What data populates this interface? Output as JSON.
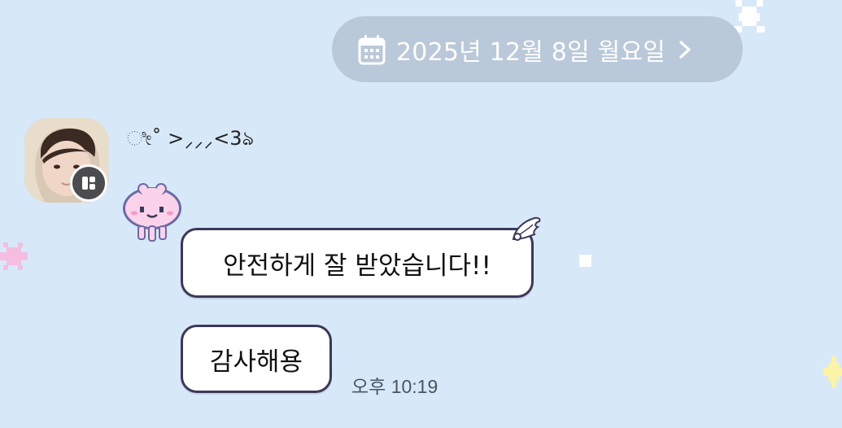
{
  "date_header": {
    "text": "2025년 12월 8일 월요일",
    "icon": "calendar-icon",
    "chevron_icon": "chevron-right-icon"
  },
  "message_group": {
    "sender_name": "ೀ˚ >⸝⸝⸝<3ঌ",
    "avatar_badge_icon": "app-badge-icon",
    "sticker": "pink-jellyfish-sticker",
    "messages": [
      {
        "text": "안전하게 잘 받았습니다!!"
      },
      {
        "text": "감사해용"
      }
    ],
    "timestamp": "오후 10:19"
  },
  "colors": {
    "background": "#d7e8f8",
    "date_pill": "#b9c9d9",
    "bubble_border": "#3b3858",
    "bubble_fill": "#ffffff",
    "timestamp": "#4c5560"
  }
}
